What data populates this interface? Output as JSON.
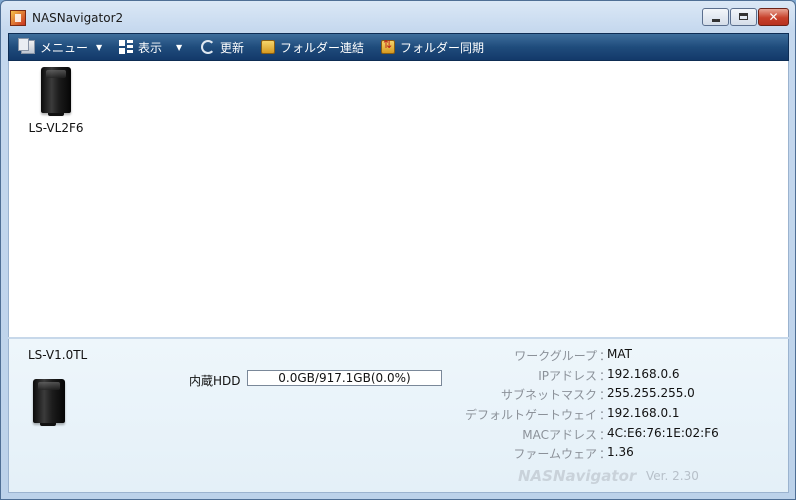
{
  "window": {
    "title": "NASNavigator2"
  },
  "toolbar": {
    "menu_label": "メニュー",
    "view_label": "表示",
    "refresh_label": "更新",
    "folder_link_label": "フォルダー連結",
    "folder_sync_label": "フォルダー同期"
  },
  "devices": [
    {
      "name": "LS-VL2F6",
      "icon": "nas-device-icon"
    }
  ],
  "info": {
    "device_name": "LS-V1.0TL",
    "hdd": {
      "label": "内蔵HDD",
      "usage_text": "0.0GB/917.1GB(0.0%)",
      "used_fraction": 0.0
    },
    "properties": [
      {
        "key": "ワークグループ",
        "value": "MAT"
      },
      {
        "key": "IPアドレス",
        "value": "192.168.0.6"
      },
      {
        "key": "サブネットマスク",
        "value": "255.255.255.0"
      },
      {
        "key": "デフォルトゲートウェイ",
        "value": "192.168.0.1"
      },
      {
        "key": "MACアドレス",
        "value": "4C:E6:76:1E:02:F6"
      },
      {
        "key": "ファームウェア",
        "value": "1.36"
      }
    ],
    "separator": "：",
    "brand": "NASNavigator",
    "version": "Ver. 2.30"
  }
}
